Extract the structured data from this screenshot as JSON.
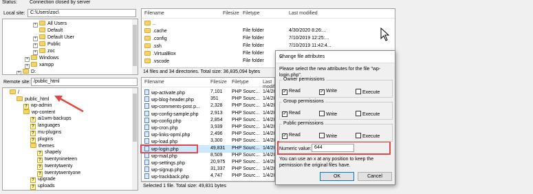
{
  "status": {
    "label": "Status:",
    "message": "Connection closed by server"
  },
  "local_site": {
    "label": "Local site:",
    "path": "C:\\Users\\zoc\\",
    "tree": [
      {
        "label": "All Users",
        "indent": 3,
        "expander": "+"
      },
      {
        "label": "Default",
        "indent": 3,
        "expander": ""
      },
      {
        "label": "Default User",
        "indent": 3,
        "expander": "+"
      },
      {
        "label": "Public",
        "indent": 3,
        "expander": "+"
      },
      {
        "label": "zoc",
        "indent": 3,
        "expander": "+"
      },
      {
        "label": "Windows",
        "indent": 2,
        "expander": "+"
      },
      {
        "label": "xampp",
        "indent": 2,
        "expander": "+"
      },
      {
        "label": "D:",
        "indent": 1,
        "expander": "+"
      }
    ]
  },
  "local_files": {
    "columns": [
      "Filename",
      "Filesize",
      "Filetype",
      "Last modified"
    ],
    "rows": [
      {
        "name": "..",
        "size": "",
        "type": "",
        "modified": ""
      },
      {
        "name": ".cache",
        "size": "",
        "type": "File folder",
        "modified": "4/30/2020 8:26:..."
      },
      {
        "name": ".config",
        "size": "",
        "type": "File folder",
        "modified": "7/10/2019 12:25:..."
      },
      {
        "name": ".ssh",
        "size": "",
        "type": "File folder",
        "modified": "7/10/2019 11:42:4..."
      },
      {
        "name": ".VirtualBox",
        "size": "",
        "type": "File folder",
        "modified": "4/29/2020 8:29:2..."
      },
      {
        "name": ".vscode",
        "size": "",
        "type": "File folder",
        "modified": ""
      }
    ],
    "status": "14 files and 34 directories. Total size: 36,835,094 bytes"
  },
  "remote_site": {
    "label": "Remote site:",
    "path": "/public_html",
    "tree": [
      {
        "label": "/",
        "indent": 0,
        "icon": "folder"
      },
      {
        "label": "public_html",
        "indent": 1,
        "icon": "folder"
      },
      {
        "label": "wp-admin",
        "indent": 2,
        "icon": "unknown"
      },
      {
        "label": "wp-content",
        "indent": 2,
        "icon": "folder"
      },
      {
        "label": "ai1wm-backups",
        "indent": 3,
        "icon": "unknown"
      },
      {
        "label": "languages",
        "indent": 3,
        "icon": "unknown"
      },
      {
        "label": "mu-plugins",
        "indent": 3,
        "icon": "unknown"
      },
      {
        "label": "plugins",
        "indent": 3,
        "icon": "unknown"
      },
      {
        "label": "themes",
        "indent": 3,
        "icon": "folder"
      },
      {
        "label": "shapely",
        "indent": 4,
        "icon": "unknown"
      },
      {
        "label": "twentynineteen",
        "indent": 4,
        "icon": "unknown"
      },
      {
        "label": "twentytwenty",
        "indent": 4,
        "icon": "unknown"
      },
      {
        "label": "twentytwentyone",
        "indent": 4,
        "icon": "unknown"
      },
      {
        "label": "upgrade",
        "indent": 3,
        "icon": "unknown"
      },
      {
        "label": "uploads",
        "indent": 3,
        "icon": "unknown"
      }
    ]
  },
  "remote_files": {
    "columns": [
      "Filename",
      "Filesize",
      "Filetype",
      "Last modified"
    ],
    "rows": [
      {
        "name": "wp-activate.php",
        "size": "7,101",
        "type": "PHP Sourc...",
        "modified": "1/4/20"
      },
      {
        "name": "wp-blog-header.php",
        "size": "351",
        "type": "PHP Sourc...",
        "modified": "1/4/20"
      },
      {
        "name": "wp-comments-post.p...",
        "size": "2,328",
        "type": "PHP Sourc...",
        "modified": "1/4/20"
      },
      {
        "name": "wp-config-sample.php",
        "size": "2,913",
        "type": "PHP Sourc...",
        "modified": "1/4/20"
      },
      {
        "name": "wp-config.php",
        "size": "2,854",
        "type": "PHP Sourc...",
        "modified": "1/4/20"
      },
      {
        "name": "wp-cron.php",
        "size": "3,939",
        "type": "PHP Sourc...",
        "modified": "1/4/20"
      },
      {
        "name": "wp-links-opml.php",
        "size": "2,496",
        "type": "PHP Sourc...",
        "modified": "1/4/20"
      },
      {
        "name": "wp-load.php",
        "size": "3,300",
        "type": "PHP Sourc...",
        "modified": "1/4/20"
      },
      {
        "name": "wp-login.php",
        "size": "49,831",
        "type": "PHP Sourc...",
        "modified": "1/4/20"
      },
      {
        "name": "wp-mail.php",
        "size": "8,509",
        "type": "PHP Sourc...",
        "modified": "1/4/20"
      },
      {
        "name": "wp-settings.php",
        "size": "20,975",
        "type": "PHP Sourc...",
        "modified": "1/4/20"
      },
      {
        "name": "wp-signup.php",
        "size": "31,337",
        "type": "PHP Sourc...",
        "modified": "1/4/20"
      },
      {
        "name": "wp-trackback.php",
        "size": "4,747",
        "type": "PHP Sourc...",
        "modified": "1/4/20"
      }
    ],
    "selected_index": 8,
    "status": "Selected 1 file. Total size: 49,831 bytes"
  },
  "dialog": {
    "title": "Change file attributes",
    "description": "Please select the new attributes for the file \"wp-login.php\".",
    "groups": [
      {
        "label": "Owner permissions",
        "read": true,
        "write": true,
        "execute": false
      },
      {
        "label": "Group permissions",
        "read": true,
        "write": false,
        "execute": false
      },
      {
        "label": "Public permissions",
        "read": true,
        "write": false,
        "execute": false
      }
    ],
    "read_label": "Read",
    "write_label": "Write",
    "execute_label": "Execute",
    "numeric_label": "Numeric value:",
    "numeric_value": "644",
    "hint": "You can use an x at any position to keep the permission the original files have.",
    "ok_label": "OK",
    "cancel_label": "Cancel",
    "close_symbol": "✕"
  },
  "colors": {
    "highlight": "#e04848",
    "selection": "#cce8ff"
  }
}
